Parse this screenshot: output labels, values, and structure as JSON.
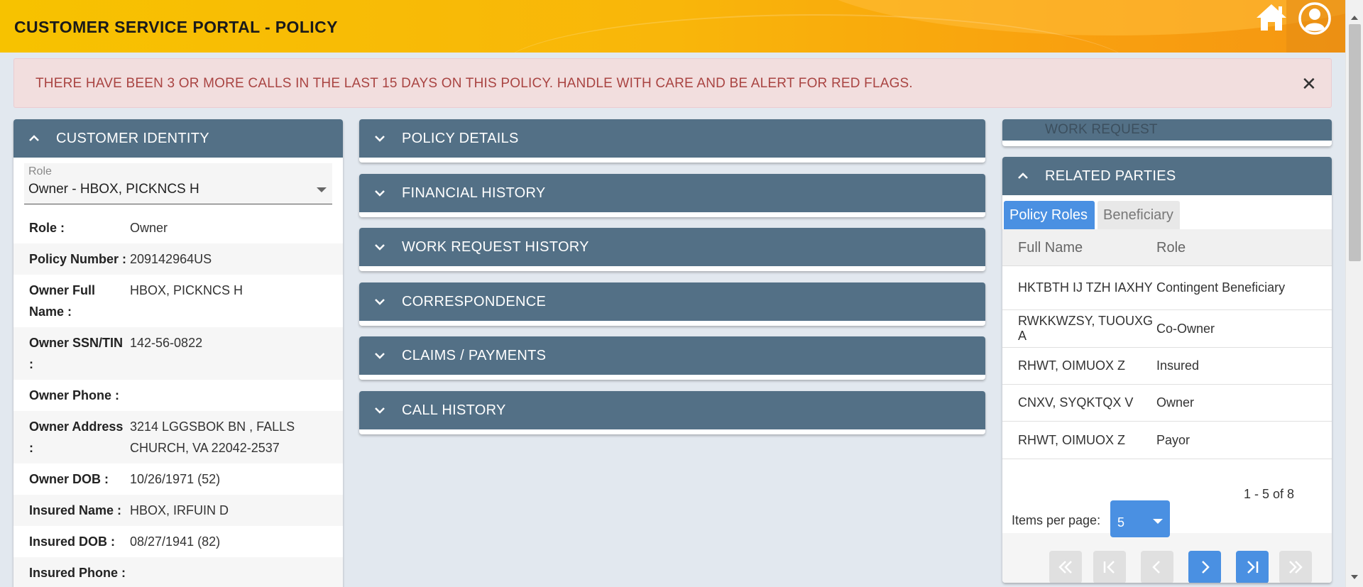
{
  "header": {
    "title": "CUSTOMER SERVICE PORTAL - POLICY",
    "home_icon": "home-icon",
    "user_icon": "user-account-icon"
  },
  "alert": {
    "message": "THERE HAVE BEEN 3 OR MORE CALLS IN THE LAST 15 DAYS ON THIS POLICY. HANDLE WITH CARE AND BE ALERT FOR RED FLAGS.",
    "close": "✕",
    "color": "#a94442"
  },
  "customer_identity": {
    "title": "CUSTOMER IDENTITY",
    "role_select": {
      "label": "Role",
      "value": "Owner - HBOX, PICKNCS H"
    },
    "fields": [
      {
        "key": "Role :",
        "value": "Owner"
      },
      {
        "key": "Policy Number :",
        "value": "209142964US"
      },
      {
        "key": "Owner Full Name :",
        "value": "HBOX, PICKNCS H"
      },
      {
        "key": "Owner SSN/TIN :",
        "value": "142-56-0822"
      },
      {
        "key": "Owner Phone :",
        "value": ""
      },
      {
        "key": "Owner Address :",
        "value": "3214 LGGSBOK BN , FALLS CHURCH, VA 22042-2537"
      },
      {
        "key": "Owner DOB :",
        "value": "10/26/1971 (52)"
      },
      {
        "key": "Insured Name :",
        "value": "HBOX, IRFUIN D"
      },
      {
        "key": "Insured DOB :",
        "value": "08/27/1941 (82)"
      },
      {
        "key": "Insured Phone :",
        "value": ""
      }
    ]
  },
  "accordions": [
    {
      "title": "POLICY DETAILS"
    },
    {
      "title": "FINANCIAL HISTORY"
    },
    {
      "title": "WORK REQUEST HISTORY"
    },
    {
      "title": "CORRESPONDENCE"
    },
    {
      "title": "CLAIMS / PAYMENTS"
    },
    {
      "title": "CALL HISTORY"
    }
  ],
  "work_request": {
    "title": "WORK REQUEST"
  },
  "related_parties": {
    "title": "RELATED PARTIES",
    "tabs": [
      "Policy Roles",
      "Beneficiary"
    ],
    "columns": [
      "Full Name",
      "Role"
    ],
    "rows": [
      {
        "name": "HKTBTH IJ TZH IAXHY",
        "role": "Contingent Beneficiary"
      },
      {
        "name": "RWKKWZSY, TUOUXG A",
        "role": "Co-Owner"
      },
      {
        "name": "RHWT, OIMUOX Z",
        "role": "Insured"
      },
      {
        "name": "CNXV, SYQKTQX V",
        "role": "Owner"
      },
      {
        "name": "RHWT, OIMUOX Z",
        "role": "Payor"
      }
    ],
    "range": "1 - 5 of 8",
    "items_per_page_label": "Items per page:",
    "items_per_page": "5"
  },
  "colors": {
    "header_gradient_start": "#f7c200",
    "header_gradient_end": "#f59712",
    "panel_header": "#537086",
    "accent_blue": "#4a90e2",
    "alert_bg": "#f2dede"
  }
}
